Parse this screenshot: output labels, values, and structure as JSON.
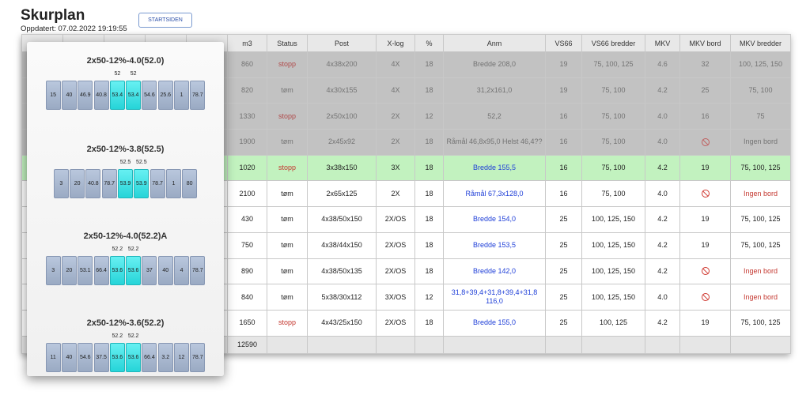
{
  "header": {
    "title": "Skurplan",
    "updated": "Oppdatert: 07.02.2022 19:19:55",
    "start_button": "STARTSIDEN"
  },
  "table": {
    "columns": [
      "m3",
      "Status",
      "Post",
      "X-log",
      "%",
      "Anm",
      "VS66",
      "VS66 bredder",
      "MKV",
      "MKV bord",
      "MKV bredder"
    ],
    "rows": [
      {
        "state": "grey",
        "m3": "860",
        "status": "stopp",
        "post": "4x38x200",
        "xlog": "4X",
        "pct": "18",
        "anm": "Bredde 208,0",
        "vs66": "19",
        "vs66b": "75, 100, 125",
        "mkv": "4.6",
        "mkvbord": "32",
        "mkvb": "100, 125, 150"
      },
      {
        "state": "grey",
        "m3": "820",
        "status": "tøm",
        "post": "4x30x155",
        "xlog": "4X",
        "pct": "18",
        "anm": "31,2x161,0",
        "vs66": "19",
        "vs66b": "75, 100",
        "mkv": "4.2",
        "mkvbord": "25",
        "mkvb": "75, 100"
      },
      {
        "state": "grey",
        "m3": "1330",
        "status": "stopp",
        "post": "2x50x100",
        "xlog": "2X",
        "pct": "12",
        "anm": "52,2",
        "vs66": "16",
        "vs66b": "75, 100",
        "mkv": "4.0",
        "mkvbord": "16",
        "mkvb": "75"
      },
      {
        "state": "grey",
        "m3": "1900",
        "status": "tøm",
        "post": "2x45x92",
        "xlog": "2X",
        "pct": "18",
        "anm": "Råmål 46,8x95,0 Helst 46,4??",
        "vs66": "16",
        "vs66b": "75, 100",
        "mkv": "4.0",
        "mkvbord": "no-entry-icon",
        "mkvb": "Ingen bord"
      },
      {
        "state": "green",
        "m3": "1020",
        "status": "stopp",
        "post": "3x38x150",
        "xlog": "3X",
        "pct": "18",
        "anm": "Bredde 155,5",
        "vs66": "16",
        "vs66b": "75, 100",
        "mkv": "4.2",
        "mkvbord": "19",
        "mkvb": "75, 100, 125"
      },
      {
        "state": "white",
        "m3": "2100",
        "status": "tøm",
        "post": "2x65x125",
        "xlog": "2X",
        "pct": "18",
        "anm": "Råmål 67,3x128,0",
        "vs66": "16",
        "vs66b": "75, 100",
        "mkv": "4.0",
        "mkvbord": "no-entry-icon",
        "mkvb": "Ingen bord"
      },
      {
        "state": "white",
        "m3": "430",
        "status": "tøm",
        "post": "4x38/50x150",
        "xlog": "2X/OS",
        "pct": "18",
        "anm": "Bredde 154,0",
        "vs66": "25",
        "vs66b": "100, 125, 150",
        "mkv": "4.2",
        "mkvbord": "19",
        "mkvb": "75, 100, 125"
      },
      {
        "state": "white",
        "m3": "750",
        "status": "tøm",
        "post": "4x38/44x150",
        "xlog": "2X/OS",
        "pct": "18",
        "anm": "Bredde 153,5",
        "vs66": "25",
        "vs66b": "100, 125, 150",
        "mkv": "4.2",
        "mkvbord": "19",
        "mkvb": "75, 100, 125"
      },
      {
        "state": "white",
        "m3": "890",
        "status": "tøm",
        "post": "4x38/50x135",
        "xlog": "2X/OS",
        "pct": "18",
        "anm": "Bredde 142,0",
        "vs66": "25",
        "vs66b": "100, 125, 150",
        "mkv": "4.2",
        "mkvbord": "no-entry-icon",
        "mkvb": "Ingen bord"
      },
      {
        "state": "white",
        "m3": "840",
        "status": "tøm",
        "post": "5x38/30x112",
        "xlog": "3X/OS",
        "pct": "12",
        "anm": "31,8+39,4+31,8+39,4+31,8 116,0",
        "vs66": "25",
        "vs66b": "100, 125, 150",
        "mkv": "4.0",
        "mkvbord": "no-entry-icon",
        "mkvb": "Ingen bord"
      },
      {
        "state": "white",
        "m3": "1650",
        "status": "stopp",
        "post": "4x43/25x150",
        "xlog": "2X/OS",
        "pct": "18",
        "anm": "Bredde 155,0",
        "vs66": "25",
        "vs66b": "100, 125",
        "mkv": "4.2",
        "mkvbord": "19",
        "mkvb": "75, 100, 125"
      }
    ],
    "total_m3": "12590"
  },
  "popup": {
    "patterns": [
      {
        "title": "2x50-12%-4.0(52.0)",
        "values": [
          "15",
          "40",
          "46.9",
          "40.8",
          "53.4",
          "53.4",
          "54.6",
          "25.6",
          "1",
          "78.7"
        ],
        "highlight": [
          4,
          5
        ],
        "labels": [
          "52",
          "52"
        ]
      },
      {
        "title": "2x50-12%-3.8(52.5)",
        "values": [
          "3",
          "20",
          "40.8",
          "78.7",
          "53.9",
          "53.9",
          "78.7",
          "1",
          "80"
        ],
        "highlight": [
          4,
          5
        ],
        "labels": [
          "52.5",
          "52.5"
        ]
      },
      {
        "title": "2x50-12%-4.0(52.2)A",
        "values": [
          "3",
          "20",
          "53.1",
          "66.4",
          "53.6",
          "53.6",
          "37",
          "40",
          "4",
          "78.7"
        ],
        "highlight": [
          4,
          5
        ],
        "labels": [
          "52.2",
          "52.2"
        ]
      },
      {
        "title": "2x50-12%-3.6(52.2)",
        "values": [
          "11",
          "40",
          "54.6",
          "37.5",
          "53.6",
          "53.6",
          "66.4",
          "3.2",
          "12",
          "78.7"
        ],
        "highlight": [
          4,
          5
        ],
        "labels": [
          "52.2",
          "52.2"
        ]
      }
    ]
  }
}
